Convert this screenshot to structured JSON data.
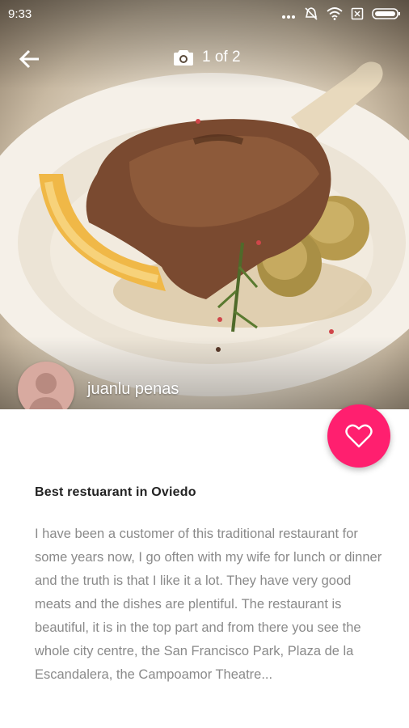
{
  "status_bar": {
    "time": "9:33",
    "icons": [
      "more-dots-icon",
      "silent-icon",
      "wifi-icon",
      "sim-off-icon",
      "battery-icon"
    ]
  },
  "toolbar": {
    "back_icon": "arrow-left-icon",
    "camera_icon": "camera-icon",
    "photo_counter": "1 of 2"
  },
  "author": {
    "name": "juanlu penas",
    "avatar_icon": "person-silhouette-icon"
  },
  "favorite": {
    "icon": "heart-outline-icon",
    "color": "#ff1f6f"
  },
  "review": {
    "title": "Best restuarant in Oviedo",
    "body": "I have been a customer of this traditional restaurant for some years now, I go often with my wife for lunch or dinner and the truth is that I like it a lot. They have very good meats and the dishes are plentiful. The restaurant is beautiful, it is in the top part and from there you see the whole city centre, the San Francisco Park, Plaza de la Escandalera, the Campoamor Theatre..."
  }
}
